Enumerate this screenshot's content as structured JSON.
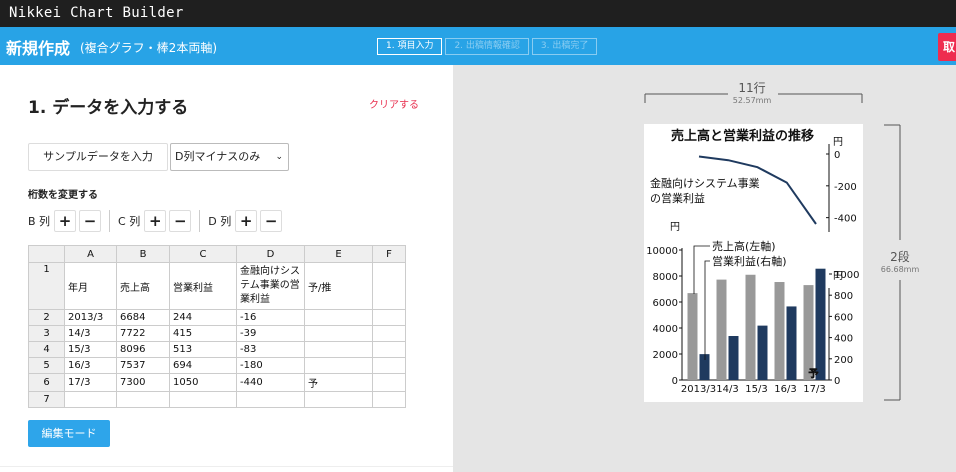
{
  "app": {
    "title": "Nikkei Chart Builder"
  },
  "header": {
    "title": "新規作成",
    "subtitle": "(複合グラフ・棒2本両軸)",
    "steps": [
      "1. 項目入力",
      "2. 出稿情報確認",
      "3. 出稿完了"
    ],
    "action_label": "取"
  },
  "left": {
    "heading": "1. データを入力する",
    "clear_label": "クリアする",
    "sample_button": "サンプルデータを入力",
    "sample_select": "D列マイナスのみ",
    "digits_label": "桁数を変更する",
    "digit_cols": [
      "B 列",
      "C 列",
      "D 列"
    ],
    "plus": "+",
    "minus": "−",
    "grid": {
      "col_headers": [
        "",
        "A",
        "B",
        "C",
        "D",
        "E",
        "F"
      ],
      "rows": [
        [
          "1",
          "年月",
          "売上高",
          "営業利益",
          "金融向けシステム事業の営業利益",
          "予/推",
          ""
        ],
        [
          "2",
          "2013/3",
          "6684",
          "244",
          "-16",
          "",
          ""
        ],
        [
          "3",
          "14/3",
          "7722",
          "415",
          "-39",
          "",
          ""
        ],
        [
          "4",
          "15/3",
          "8096",
          "513",
          "-83",
          "",
          ""
        ],
        [
          "5",
          "16/3",
          "7537",
          "694",
          "-180",
          "",
          ""
        ],
        [
          "6",
          "17/3",
          "7300",
          "1050",
          "-440",
          "予",
          ""
        ],
        [
          "7",
          "",
          "",
          "",
          "",
          "",
          ""
        ]
      ]
    },
    "edit_button": "編集モード"
  },
  "preview": {
    "width_label": "11行",
    "width_mm": "52.57mm",
    "height_label": "2段",
    "height_mm": "66.68mm"
  },
  "colors": {
    "accent": "#28a3e6",
    "danger": "#e8304f",
    "bar_sales": "#999999",
    "bar_profit": "#1f3a5f",
    "line": "#1f3a5f"
  },
  "chart_data": [
    {
      "type": "line",
      "title": "売上高と営業利益の推移",
      "series": [
        {
          "name": "金融向けシステム事業の営業利益",
          "values": [
            -16,
            -39,
            -83,
            -180,
            -440
          ]
        }
      ],
      "categories": [
        "2013/3",
        "14/3",
        "15/3",
        "16/3",
        "17/3"
      ],
      "ylabel": "円",
      "ylim": [
        -440,
        0
      ],
      "yticks": [
        "0",
        "-200",
        "-400"
      ]
    },
    {
      "type": "bar",
      "categories": [
        "2013/3",
        "14/3",
        "15/3",
        "16/3",
        "17/3"
      ],
      "series": [
        {
          "name": "売上高(左軸)",
          "values": [
            6684,
            7722,
            8096,
            7537,
            7300
          ],
          "axis": "left"
        },
        {
          "name": "営業利益(右軸)",
          "values": [
            244,
            415,
            513,
            694,
            1050
          ],
          "axis": "right"
        }
      ],
      "y_left_label": "円",
      "y_left_lim": [
        0,
        10000
      ],
      "y_left_ticks": [
        "0",
        "2000",
        "4000",
        "6000",
        "8000",
        "10000"
      ],
      "y_right_label": "円",
      "y_right_lim": [
        0,
        1000
      ],
      "y_right_ticks": [
        "0",
        "200",
        "400",
        "600",
        "800",
        "1000"
      ],
      "annotation": "予"
    }
  ]
}
